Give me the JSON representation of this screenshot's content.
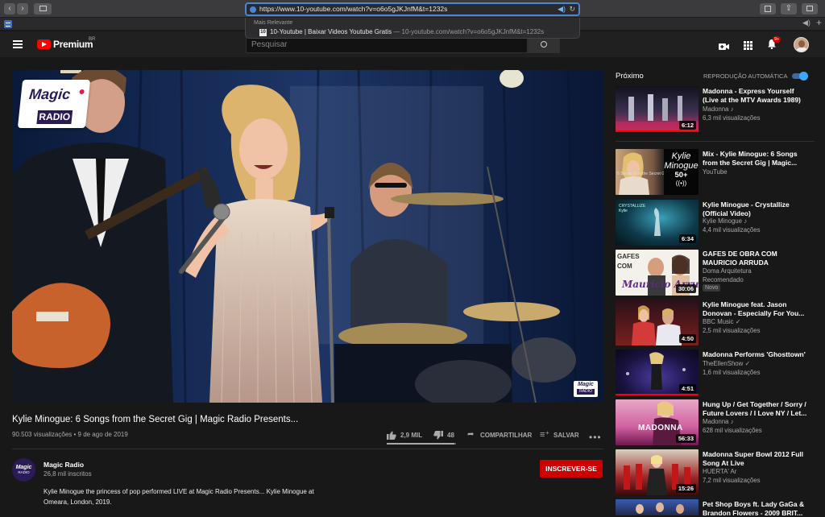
{
  "browser": {
    "url": "https://www.10-youtube.com/watch?v=o6o5gJKJnfM&t=1232s",
    "dropdown_header": "Mais Relevante",
    "favicon_text": "10",
    "suggestion_title": "10-Youtube | Baixar Videos Youtube Gratis",
    "suggestion_url": "— 10-youtube.com/watch?v=o6o5gJKJnfM&t=1232s"
  },
  "header": {
    "logo_text": "Premium",
    "logo_country": "BR",
    "search_placeholder": "Pesquisar",
    "notifications_badge": "9+"
  },
  "video": {
    "overlay_brand": "Magic",
    "overlay_sub": "RADIO",
    "corner_brand": "Magic",
    "corner_sub": "RADIO",
    "title": "Kylie Minogue: 6 Songs from the Secret Gig | Magic Radio Presents...",
    "views": "90.503 visualizações • 9 de ago de 2019",
    "likes": "2,9 MIL",
    "dislikes": "48",
    "share_label": "COMPARTILHAR",
    "save_label": "SALVAR",
    "like_ratio": 0.98
  },
  "channel": {
    "name": "Magic Radio",
    "subscribers": "26,8 mil inscritos",
    "avatar_text": "Magic",
    "avatar_sub": "RADIO",
    "subscribe_label": "INSCREVER-SE",
    "description_line1": "Kylie Minogue the princess of pop performed LIVE at Magic Radio Presents... Kylie Minogue at",
    "description_line2": "Omeara, London, 2019."
  },
  "sidebar": {
    "next_label": "Próximo",
    "autoplay_label": "REPRODUÇÃO AUTOMÁTICA",
    "autoplay_on": true,
    "items": [
      {
        "title1": "Madonna - Express Yourself",
        "title2": "(Live at the MTV Awards 1989)",
        "channel": "Madonna ♪",
        "views": "6,3 mil visualizações",
        "duration": "6:12",
        "progress": 1.0
      },
      {
        "title1": "Mix - Kylie Minogue: 6 Songs",
        "title2": "from the Secret Gig | Magic...",
        "channel": "YouTube",
        "views": "",
        "duration": "",
        "mix_count": "50+",
        "mix_thumb_text": "Kylie Minogue",
        "mix_thumb_sub": "6 Songs from the Secret Gig"
      },
      {
        "title1": "Kylie Minogue - Crystallize",
        "title2": "(Official Video)",
        "channel": "Kylie Minogue ♪",
        "views": "4,4 mil visualizações",
        "duration": "6:34",
        "thumb_text": "CRYSTALLIZE Kylie"
      },
      {
        "title1": "GAFES DE OBRA COM",
        "title2": "MAURICIO ARRUDA",
        "channel": "Doma Arquitetura",
        "views": "Recomendado",
        "badge": "Novo",
        "duration": "30:06",
        "thumb_text": "GAFES COM",
        "thumb_script": "Mauricio Arruda"
      },
      {
        "title1": "Kylie Minogue feat. Jason",
        "title2": "Donovan - Especially For You...",
        "channel": "BBC Music ✓",
        "views": "2,5 mil visualizações",
        "duration": "4:50"
      },
      {
        "title1": "Madonna Performs 'Ghosttown'",
        "title2": "",
        "channel": "TheEllenShow ✓",
        "views": "1,6 mil visualizações",
        "duration": "4:51",
        "progress": 1.0
      },
      {
        "title1": "Hung Up / Get Together / Sorry /",
        "title2": "Future Lovers / I Love NY / Let...",
        "channel": "Madonna ♪",
        "views": "628 mil visualizações",
        "duration": "56:33",
        "thumb_text": "MADONNA"
      },
      {
        "title1": "Madonna Super Bowl 2012 Full",
        "title2": "Song At Live",
        "channel": "HUERTA' Ar",
        "views": "7,2 mil visualizações",
        "duration": "15:26"
      },
      {
        "title1": "Pet Shop Boys ft. Lady GaGa &",
        "title2": "Brandon Flowers - 2009 BRIT...",
        "channel": "",
        "views": "",
        "duration": ""
      }
    ]
  },
  "colors": {
    "bg": "#181818",
    "accent_red": "#cc0000",
    "toggle_blue": "#3ea6ff",
    "addr_blue": "#4a86d4"
  }
}
